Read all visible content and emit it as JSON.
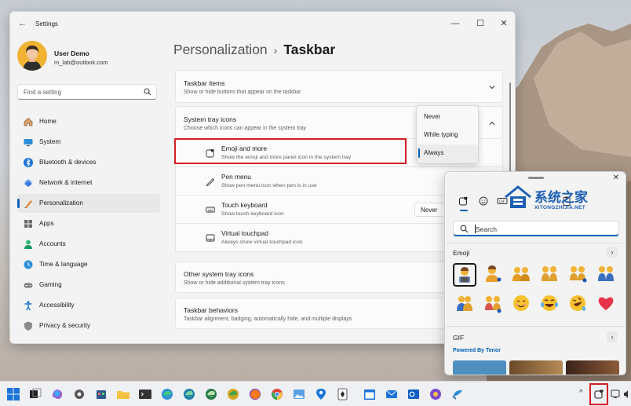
{
  "window": {
    "title": "Settings",
    "controls": {
      "minimize": "—",
      "maximize": "☐",
      "close": "✕"
    }
  },
  "user": {
    "name": "User Demo",
    "email": "m_lab@outlook.com"
  },
  "search": {
    "placeholder": "Find a setting"
  },
  "nav": {
    "items": [
      {
        "label": "Home",
        "icon": "home-icon"
      },
      {
        "label": "System",
        "icon": "monitor-icon"
      },
      {
        "label": "Bluetooth & devices",
        "icon": "bluetooth-icon"
      },
      {
        "label": "Network & internet",
        "icon": "wifi-icon"
      },
      {
        "label": "Personalization",
        "icon": "brush-icon",
        "active": true
      },
      {
        "label": "Apps",
        "icon": "apps-icon"
      },
      {
        "label": "Accounts",
        "icon": "person-icon"
      },
      {
        "label": "Time & language",
        "icon": "globe-clock-icon"
      },
      {
        "label": "Gaming",
        "icon": "gamepad-icon"
      },
      {
        "label": "Accessibility",
        "icon": "accessibility-icon"
      },
      {
        "label": "Privacy & security",
        "icon": "shield-icon"
      }
    ]
  },
  "breadcrumb": {
    "parent": "Personalization",
    "separator": "›",
    "current": "Taskbar"
  },
  "sections": {
    "taskbar_items": {
      "title": "Taskbar items",
      "subtitle": "Show or hide buttons that appear on the taskbar"
    },
    "system_tray_icons": {
      "title": "System tray icons",
      "subtitle": "Choose which icons can appear in the system tray"
    },
    "other_tray": {
      "title": "Other system tray icons",
      "subtitle": "Show or hide additional system tray icons"
    },
    "behaviors": {
      "title": "Taskbar behaviors",
      "subtitle": "Taskbar alignment, badging, automatically hide, and multiple displays"
    }
  },
  "tray_rows": [
    {
      "title": "Emoji and more",
      "subtitle": "Show the emoji and more panel icon in the system tray",
      "icon": "emoji-heart-icon"
    },
    {
      "title": "Pen menu",
      "subtitle": "Show pen menu icon when pen is in use",
      "icon": "pen-icon"
    },
    {
      "title": "Touch keyboard",
      "subtitle": "Show touch keyboard icon",
      "icon": "keyboard-icon",
      "value": "Never"
    },
    {
      "title": "Virtual touchpad",
      "subtitle": "Always show virtual touchpad icon",
      "icon": "touchpad-icon"
    }
  ],
  "dropdown": {
    "options": [
      "Never",
      "While typing",
      "Always"
    ],
    "selected": "Always"
  },
  "emoji_panel": {
    "search_placeholder": "Search",
    "emoji_section": "Emoji",
    "gif_section": "GIF",
    "powered_by": "Powered By Tenor",
    "more": "›",
    "tabs": [
      "emoji-heart-icon",
      "smiley-icon",
      "gif-icon",
      "clipboard-icon"
    ],
    "watermark": {
      "title": "系统之家",
      "subtitle": "XITONGZHIJIA.NET"
    }
  },
  "colors": {
    "accent": "#005fb8",
    "highlight": "#d41e25",
    "window_bg": "#f3f3f3"
  }
}
